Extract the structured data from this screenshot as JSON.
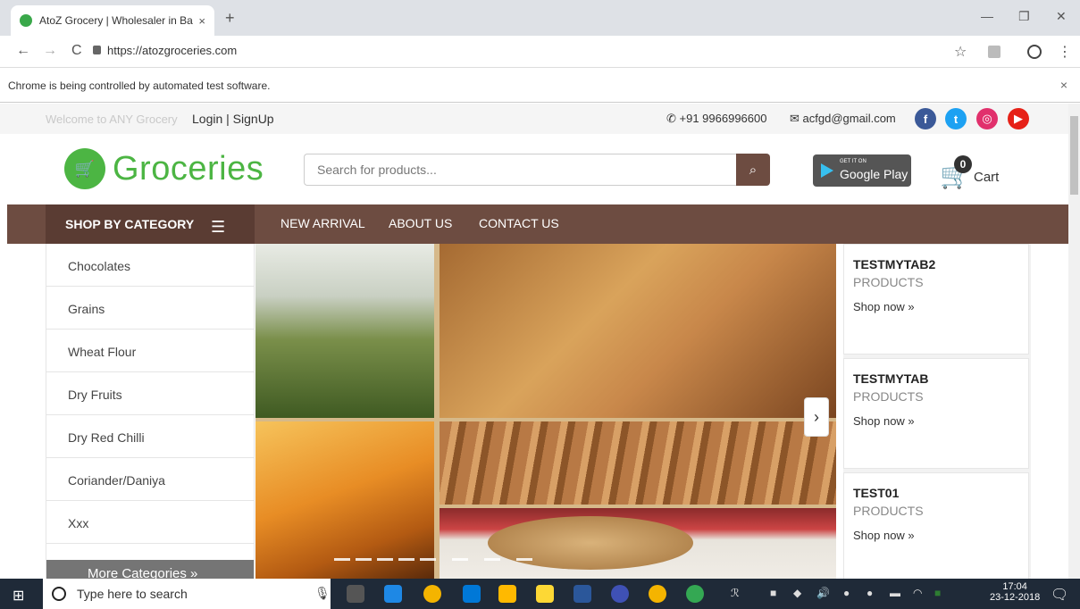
{
  "browser": {
    "tab_title": "AtoZ Grocery | Wholesaler in Ban",
    "tab_close": "×",
    "new_tab": "+",
    "url": "https://atozgroceries.com",
    "infobar_message": "Chrome is being controlled by automated test software.",
    "infobar_close": "×",
    "minimize": "—",
    "restore": "❐",
    "close": "✕",
    "back": "←",
    "forward": "→",
    "reload": "C",
    "star": "☆",
    "menu": "⋮"
  },
  "topbar": {
    "welcome": "Welcome to ANY Grocery",
    "login_signup": "Login | SignUp",
    "phone": "+91 9966996600",
    "email": "acfgd@gmail.com",
    "social": [
      {
        "name": "facebook",
        "glyph": "f",
        "color": "#3b5998"
      },
      {
        "name": "twitter",
        "glyph": "t",
        "color": "#1da1f2"
      },
      {
        "name": "instagram",
        "glyph": "◎",
        "color": "#e1306c"
      },
      {
        "name": "youtube",
        "glyph": "▶",
        "color": "#e62117"
      }
    ]
  },
  "header": {
    "logo_text": "Groceries",
    "search_placeholder": "Search for products...",
    "gplay_small": "GET IT ON",
    "gplay_big": "Google Play",
    "cart_count": "0",
    "cart_label": "Cart"
  },
  "nav": {
    "shop_by_category": "SHOP BY CATEGORY",
    "links": [
      "NEW ARRIVAL",
      "ABOUT US",
      "CONTACT US"
    ]
  },
  "categories": {
    "items": [
      "Chocolates",
      "Grains",
      "Wheat Flour",
      "Dry Fruits",
      "Dry Red Chilli",
      "Coriander/Daniya",
      "Xxx"
    ],
    "more": "More Categories »"
  },
  "promos": [
    {
      "title": "TESTMYTAB2",
      "subtitle": "PRODUCTS",
      "link": "Shop now »"
    },
    {
      "title": "TESTMYTAB",
      "subtitle": "PRODUCTS",
      "link": "Shop now »"
    },
    {
      "title": "TEST01",
      "subtitle": "PRODUCTS",
      "link": "Shop now »"
    }
  ],
  "taskbar": {
    "search_placeholder": "Type here to search",
    "time": "17:04",
    "date": "23-12-2018"
  },
  "colors": {
    "brand_green": "#4cb543",
    "nav_brown": "#6d4c41"
  }
}
